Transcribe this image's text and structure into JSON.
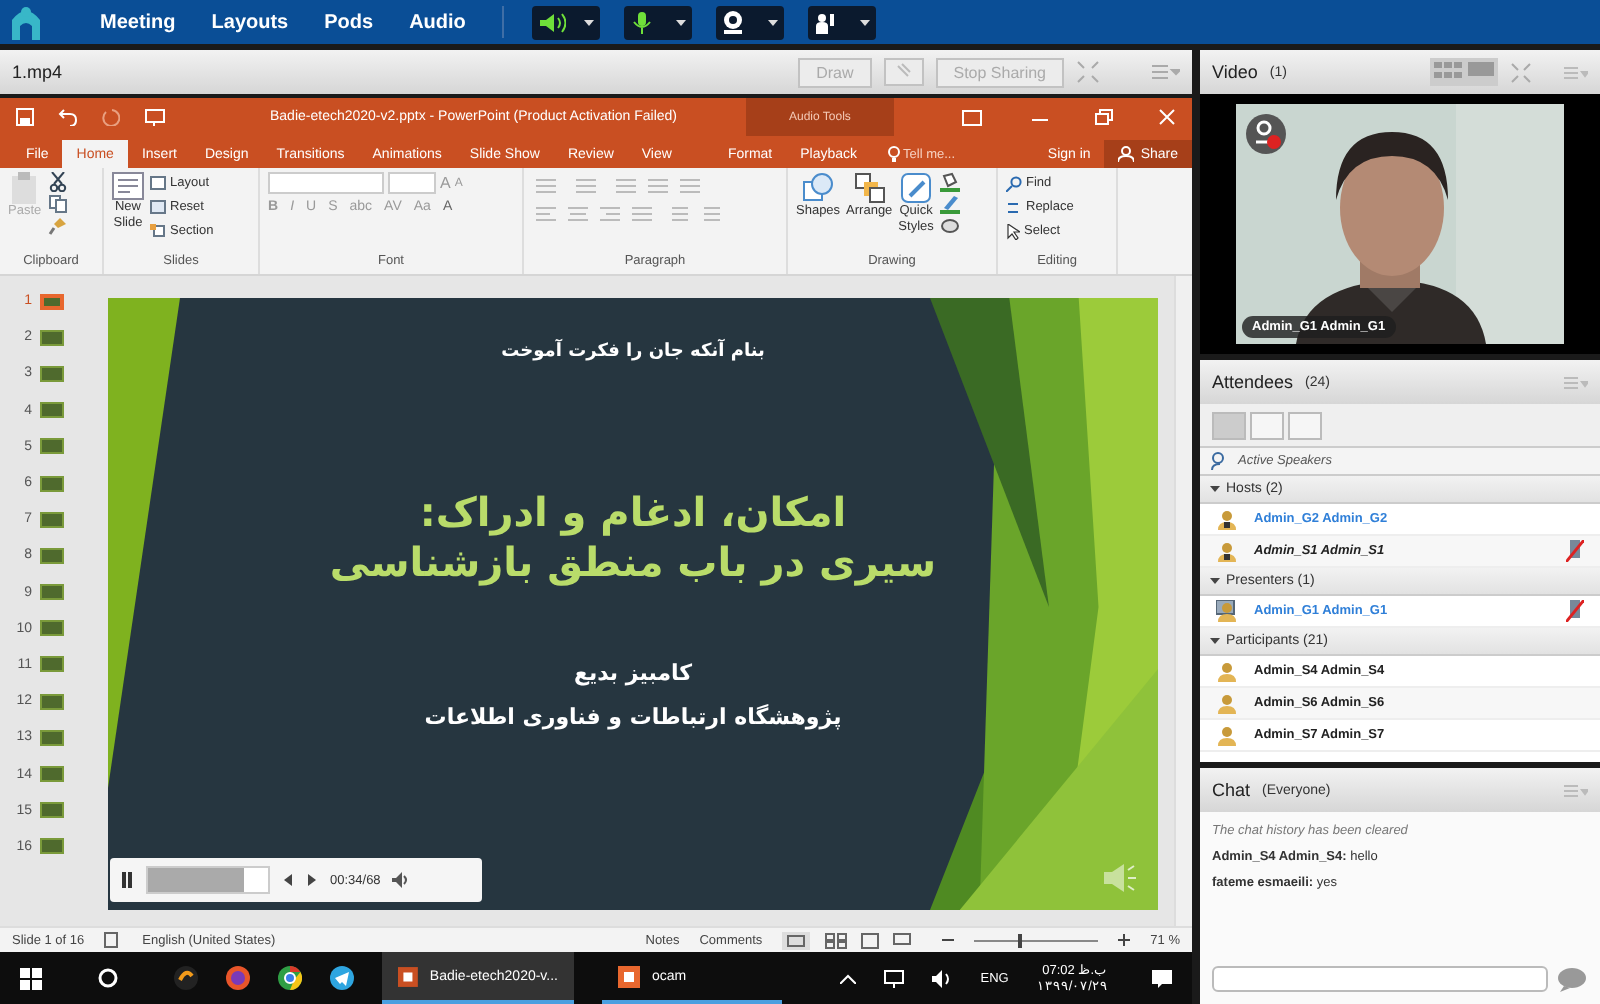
{
  "top_bar": {
    "menu": [
      "Meeting",
      "Layouts",
      "Pods",
      "Audio"
    ],
    "controls": [
      {
        "kind": "speaker",
        "on": true
      },
      {
        "kind": "mic",
        "on": true
      },
      {
        "kind": "camera",
        "on": false
      },
      {
        "kind": "hand",
        "on": false
      }
    ]
  },
  "share_pod": {
    "title": "1.mp4",
    "buttons": [
      "Draw",
      "Stop Sharing"
    ]
  },
  "powerpoint": {
    "title": "Badie-etech2020-v2.pptx - PowerPoint (Product Activation Failed)",
    "context_group": "Audio Tools",
    "tabs": [
      {
        "label": "File",
        "selected": false
      },
      {
        "label": "Home",
        "selected": true
      },
      {
        "label": "Insert",
        "selected": false
      },
      {
        "label": "Design",
        "selected": false
      },
      {
        "label": "Transitions",
        "selected": false
      },
      {
        "label": "Animations",
        "selected": false
      },
      {
        "label": "Slide Show",
        "selected": false
      },
      {
        "label": "Review",
        "selected": false
      },
      {
        "label": "View",
        "selected": false
      },
      {
        "label": "Format",
        "selected": false
      },
      {
        "label": "Playback",
        "selected": false
      }
    ],
    "tell_me": "Tell me...",
    "sign_in": "Sign in",
    "share": "Share",
    "ribbon": {
      "paste": "Paste",
      "clipboard": "Clipboard",
      "new_slide": [
        "New",
        "Slide"
      ],
      "layout": "Layout",
      "reset": "Reset",
      "section": "Section",
      "slides": "Slides",
      "font_buttons": [
        "B",
        "I",
        "U",
        "S",
        "abc",
        "AV",
        "Aa",
        "A"
      ],
      "font_size_buttons": [
        "A",
        "A"
      ],
      "font": "Font",
      "paragraph": "Paragraph",
      "shapes": "Shapes",
      "arrange": "Arrange",
      "quick_styles": [
        "Quick",
        "Styles"
      ],
      "drawing": "Drawing",
      "find": "Find",
      "replace": "Replace",
      "select": "Select",
      "editing": "Editing"
    },
    "thumbnails": [
      {
        "number": "1",
        "selected": true
      },
      {
        "number": "2",
        "selected": false
      },
      {
        "number": "3",
        "selected": false
      },
      {
        "number": "4",
        "selected": false
      },
      {
        "number": "5",
        "selected": false
      },
      {
        "number": "6",
        "selected": false
      },
      {
        "number": "7",
        "selected": false
      },
      {
        "number": "8",
        "selected": false
      },
      {
        "number": "9",
        "selected": false
      },
      {
        "number": "10",
        "selected": false
      },
      {
        "number": "11",
        "selected": false
      },
      {
        "number": "12",
        "selected": false
      },
      {
        "number": "13",
        "selected": false
      },
      {
        "number": "14",
        "selected": false
      },
      {
        "number": "15",
        "selected": false
      },
      {
        "number": "16",
        "selected": false
      }
    ],
    "slide": {
      "motto": "بنام آنکه جان را فکرت آموخت",
      "title_lines": [
        "امکان، ادغام و ادراک:",
        "سیری در باب منطق بازشناسی"
      ],
      "author": "کامبیز بدیع",
      "institute": "پژوهشگاه ارتباطات و فناوری اطلاعات"
    },
    "media": {
      "playing": true,
      "level": 0.8,
      "time": "00:34/68"
    },
    "status_bar": {
      "slide_info": "Slide 1 of 16",
      "language": "English (United States)",
      "notes": "Notes",
      "comments": "Comments",
      "zoom_slider": {
        "level": 0.36
      },
      "zoom": "71 %"
    }
  },
  "taskbar": {
    "windows": [
      {
        "label": "Badie-etech2020-v...",
        "selected": true
      },
      {
        "label": "ocam",
        "selected": false
      }
    ],
    "language": "ENG",
    "time": "07:02 ب.ظ",
    "date": "۱۳۹۹/۰۷/۲۹"
  },
  "video_pod": {
    "title": "Video",
    "count": "(1)",
    "caption": "Admin_G1 Admin_G1"
  },
  "attendees": {
    "title": "Attendees",
    "count": "(24)",
    "active_speakers": "Active Speakers",
    "groups": [
      {
        "name": "Hosts (2)",
        "expanded": true,
        "kind": "host",
        "members": [
          {
            "name": "Admin_G2 Admin_G2",
            "color": "#2f7fd8",
            "muted": false
          },
          {
            "name": "Admin_S1 Admin_S1",
            "color": "#222222",
            "muted": true
          }
        ]
      },
      {
        "name": "Presenters (1)",
        "expanded": true,
        "kind": "presenter",
        "members": [
          {
            "name": "Admin_G1 Admin_G1",
            "color": "#2f7fd8",
            "muted": true
          }
        ]
      },
      {
        "name": "Participants (21)",
        "expanded": true,
        "kind": "participant",
        "members": [
          {
            "name": "Admin_S4 Admin_S4",
            "color": "#222222",
            "muted": false
          },
          {
            "name": "Admin_S6 Admin_S6",
            "color": "#222222",
            "muted": false
          },
          {
            "name": "Admin_S7 Admin_S7",
            "color": "#222222",
            "muted": false
          }
        ]
      }
    ]
  },
  "chat": {
    "title": "Chat",
    "audience": "(Everyone)",
    "notice": "The chat history has been cleared",
    "messages": [
      {
        "sender": "Admin_S4 Admin_S4:",
        "text": "hello"
      },
      {
        "sender": "fateme esmaeili:",
        "text": "yes"
      }
    ]
  }
}
